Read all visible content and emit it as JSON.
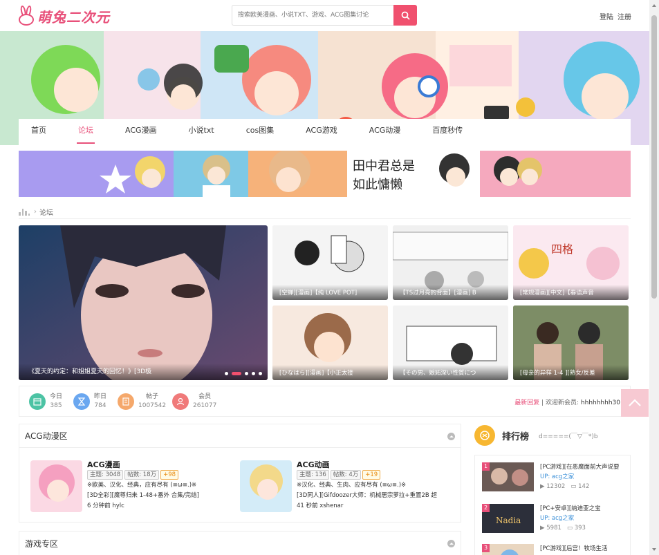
{
  "logo": {
    "text": "萌兔二次元"
  },
  "search": {
    "placeholder": "搜索欧美漫画、小说TXT、游戏、ACG图集讨论"
  },
  "auth": {
    "login": "登陆",
    "register": "注册"
  },
  "nav": [
    "首页",
    "论坛",
    "ACG漫画",
    "小说txt",
    "cos图集",
    "ACG游戏",
    "ACG动漫",
    "百度秒传"
  ],
  "breadcrumb": {
    "current": "论坛"
  },
  "hero": {
    "caption": "《夏天的约定：和姐姐夏天的回忆！》[3D极"
  },
  "thumbs": [
    "[空蝉][漫画]【纯 LOVE POT]",
    "【TS过月亮的背面】[漫画] B",
    "[常规漫画][中文]【春语声音",
    "[ひなはら][漫画]【小正太接",
    "【その男、嫉妬深い性質につ",
    "[母亲的异样 1-4 ][熟女/反差"
  ],
  "stats": [
    {
      "label": "今日",
      "value": "385"
    },
    {
      "label": "昨日",
      "value": "784"
    },
    {
      "label": "帖子",
      "value": "1007542"
    },
    {
      "label": "会员",
      "value": "261077"
    }
  ],
  "news": {
    "latest": "最新回复",
    "welcome": "欢迎新会员:",
    "member": "hhhhhhhh30"
  },
  "blocks": {
    "acg": {
      "title": "ACG动漫区",
      "sections": [
        {
          "name": "ACG漫画",
          "topics": "主题: 3048",
          "posts": "帖数: 18万",
          "plus": "+98",
          "desc": "※欧美、汉化、经典，应有尽有 (≡ω≡.)※",
          "last": "[3D全彩][魔尊归来 1-48+番外 合集/完结]",
          "time": "6 分钟前 hylc"
        },
        {
          "name": "ACG动画",
          "topics": "主题: 136",
          "posts": "帖数: 4万",
          "plus": "+19",
          "desc": "※汉化、经典、生肉、应有尽有 (≡ω≡.)※",
          "last": "[3D同人][Gifdoozer大师：机械居宗萝拉+重置2B 超",
          "time": "41 秒前 xshenar"
        }
      ]
    },
    "game": {
      "title": "游戏专区"
    }
  },
  "side": {
    "title": "排行榜",
    "sub": "d=====(￣▽￣*)b",
    "items": [
      {
        "no": "1",
        "title": "[PC游戏][在恶魔面前大声说要",
        "up": "UP: acg之家",
        "views": "12302",
        "comments": "142"
      },
      {
        "no": "2",
        "title": "[PC+安卓][纳迪亚之宝",
        "up": "UP: acg之家",
        "views": "5981",
        "comments": "393"
      },
      {
        "no": "3",
        "title": "[PC游戏][后宫！牧场生活",
        "up": "",
        "views": "",
        "comments": ""
      }
    ]
  },
  "colors": {
    "accent": "#e8507a",
    "search_btn": "#f0506e",
    "rank_up": "#3a8fd8"
  }
}
